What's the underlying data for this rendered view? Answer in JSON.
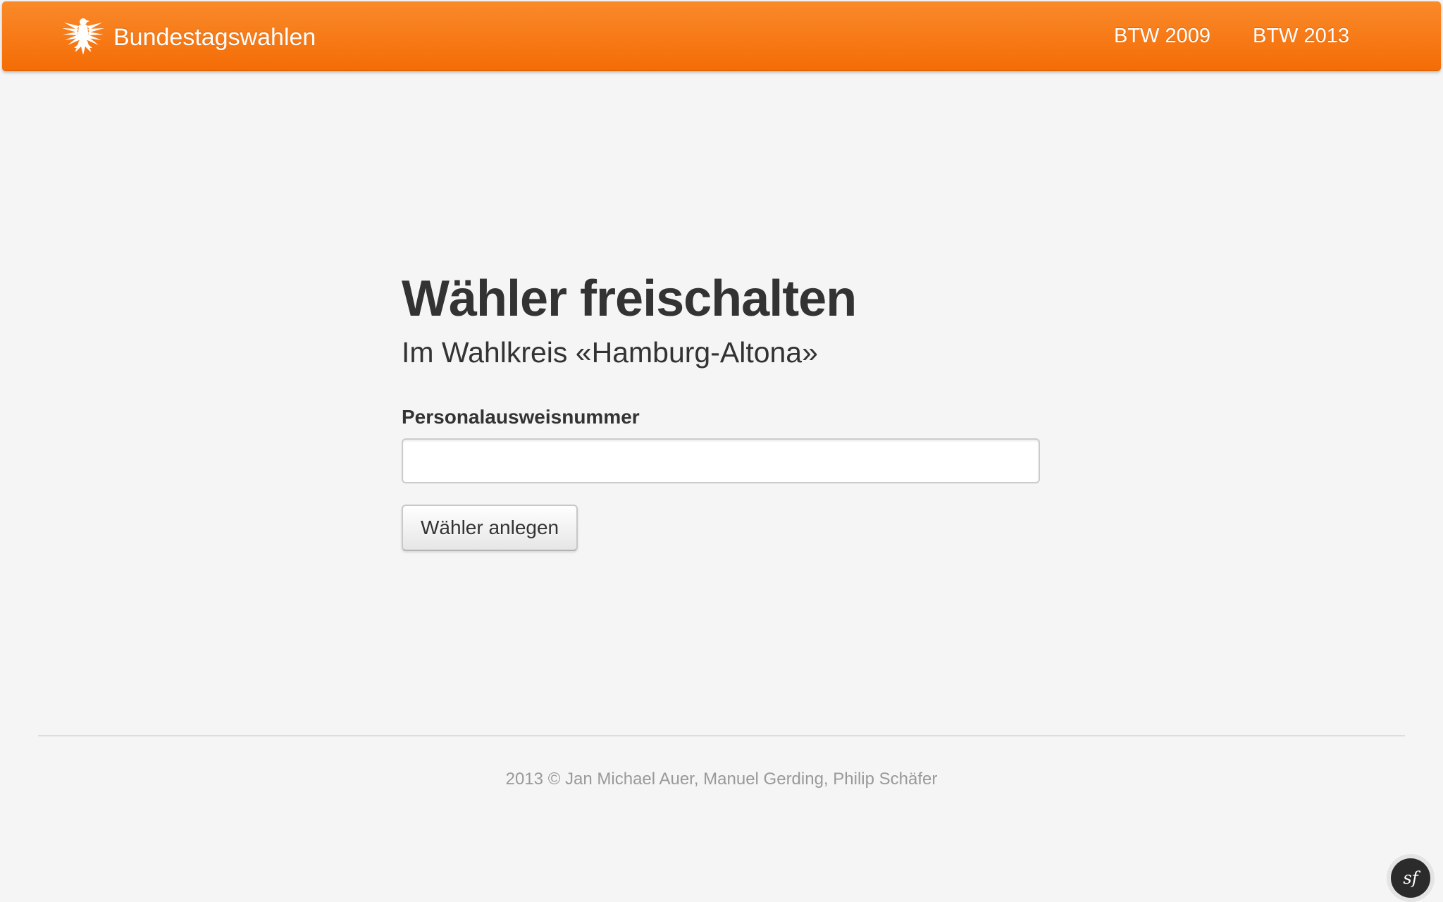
{
  "navbar": {
    "brand": "Bundestagswahlen",
    "brand_icon": "eagle-icon",
    "links": [
      {
        "label": "BTW 2009"
      },
      {
        "label": "BTW 2013"
      }
    ]
  },
  "main": {
    "title": "Wähler freischalten",
    "subtitle": "Im Wahlkreis «Hamburg-Altona»",
    "id_field": {
      "label": "Personalausweisnummer",
      "value": "",
      "placeholder": ""
    },
    "submit_label": "Wähler anlegen"
  },
  "footer": {
    "text": "2013 © Jan Michael Auer, Manuel Gerding, Philip Schäfer"
  },
  "debug_toolbar": {
    "icon": "symfony-icon"
  },
  "colors": {
    "navbar_top": "#fa8a2a",
    "navbar_bottom": "#f46c06",
    "background": "#f5f5f5",
    "text": "#333333",
    "footer_text": "#999999"
  }
}
